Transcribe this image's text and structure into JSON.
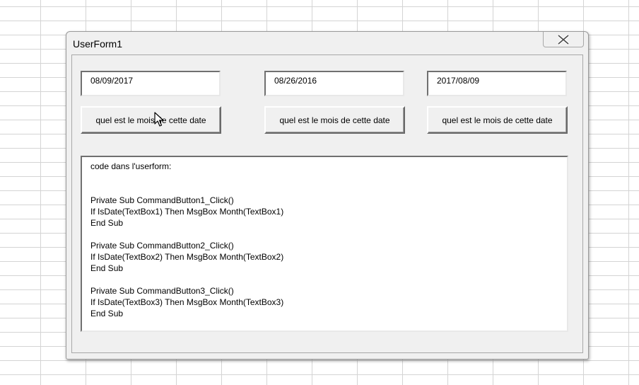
{
  "window": {
    "title": "UserForm1",
    "close_icon": "close-icon"
  },
  "textboxes": [
    "08/09/2017",
    "08/26/2016",
    "2017/08/09"
  ],
  "buttons": [
    "quel est le mois de cette date",
    "quel est le mois de cette date",
    "quel est le mois de cette date"
  ],
  "code_text": "code dans l'userform:\n\n\nPrivate Sub CommandButton1_Click()\nIf IsDate(TextBox1) Then MsgBox Month(TextBox1)\nEnd Sub\n\nPrivate Sub CommandButton2_Click()\nIf IsDate(TextBox2) Then MsgBox Month(TextBox2)\nEnd Sub\n\nPrivate Sub CommandButton3_Click()\nIf IsDate(TextBox3) Then MsgBox Month(TextBox3)\nEnd Sub",
  "icons": {
    "cursor": "mouse-cursor-icon"
  }
}
